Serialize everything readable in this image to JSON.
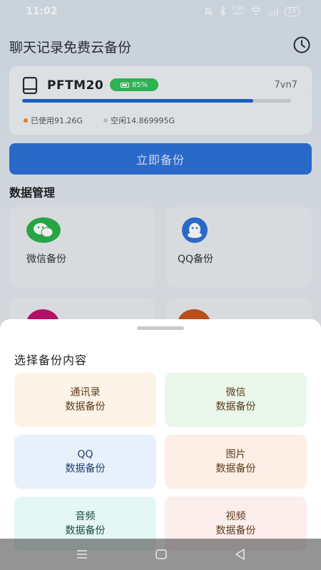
{
  "status_bar": {
    "time": "11:02",
    "net_speed": "2.00",
    "net_unit": "KB/S",
    "battery": "24"
  },
  "app": {
    "title": "聊天记录免费云备份",
    "device": {
      "name": "PFTM20",
      "battery_percent": "85%",
      "code": "7vn7",
      "storage_used_fraction": 0.86,
      "used_label": "已使用91.26G",
      "free_label": "空闲14.869995G"
    },
    "backup_button": "立即备份",
    "section_title": "数据管理",
    "tiles": [
      {
        "label": "微信备份",
        "icon": "wechat-icon"
      },
      {
        "label": "QQ备份",
        "icon": "qq-icon"
      }
    ]
  },
  "sheet": {
    "title": "选择备份内容",
    "options": [
      {
        "line1": "通讯录",
        "line2": "数据备份",
        "bg": "#fdf3e6"
      },
      {
        "line1": "微信",
        "line2": "数据备份",
        "bg": "#eaf7ea"
      },
      {
        "line1": "QQ",
        "line2": "数据备份",
        "bg": "#e8f0fc"
      },
      {
        "line1": "图片",
        "line2": "数据备份",
        "bg": "#fdeee6"
      },
      {
        "line1": "音频",
        "line2": "数据备份",
        "bg": "#e4f7f4"
      },
      {
        "line1": "视频",
        "line2": "数据备份",
        "bg": "#fdeeee"
      }
    ]
  },
  "colors": {
    "primary": "#2f72d9",
    "battery_green": "#33c05a",
    "used_dot": "#f08a24",
    "free_dot": "#c8c8c8"
  }
}
